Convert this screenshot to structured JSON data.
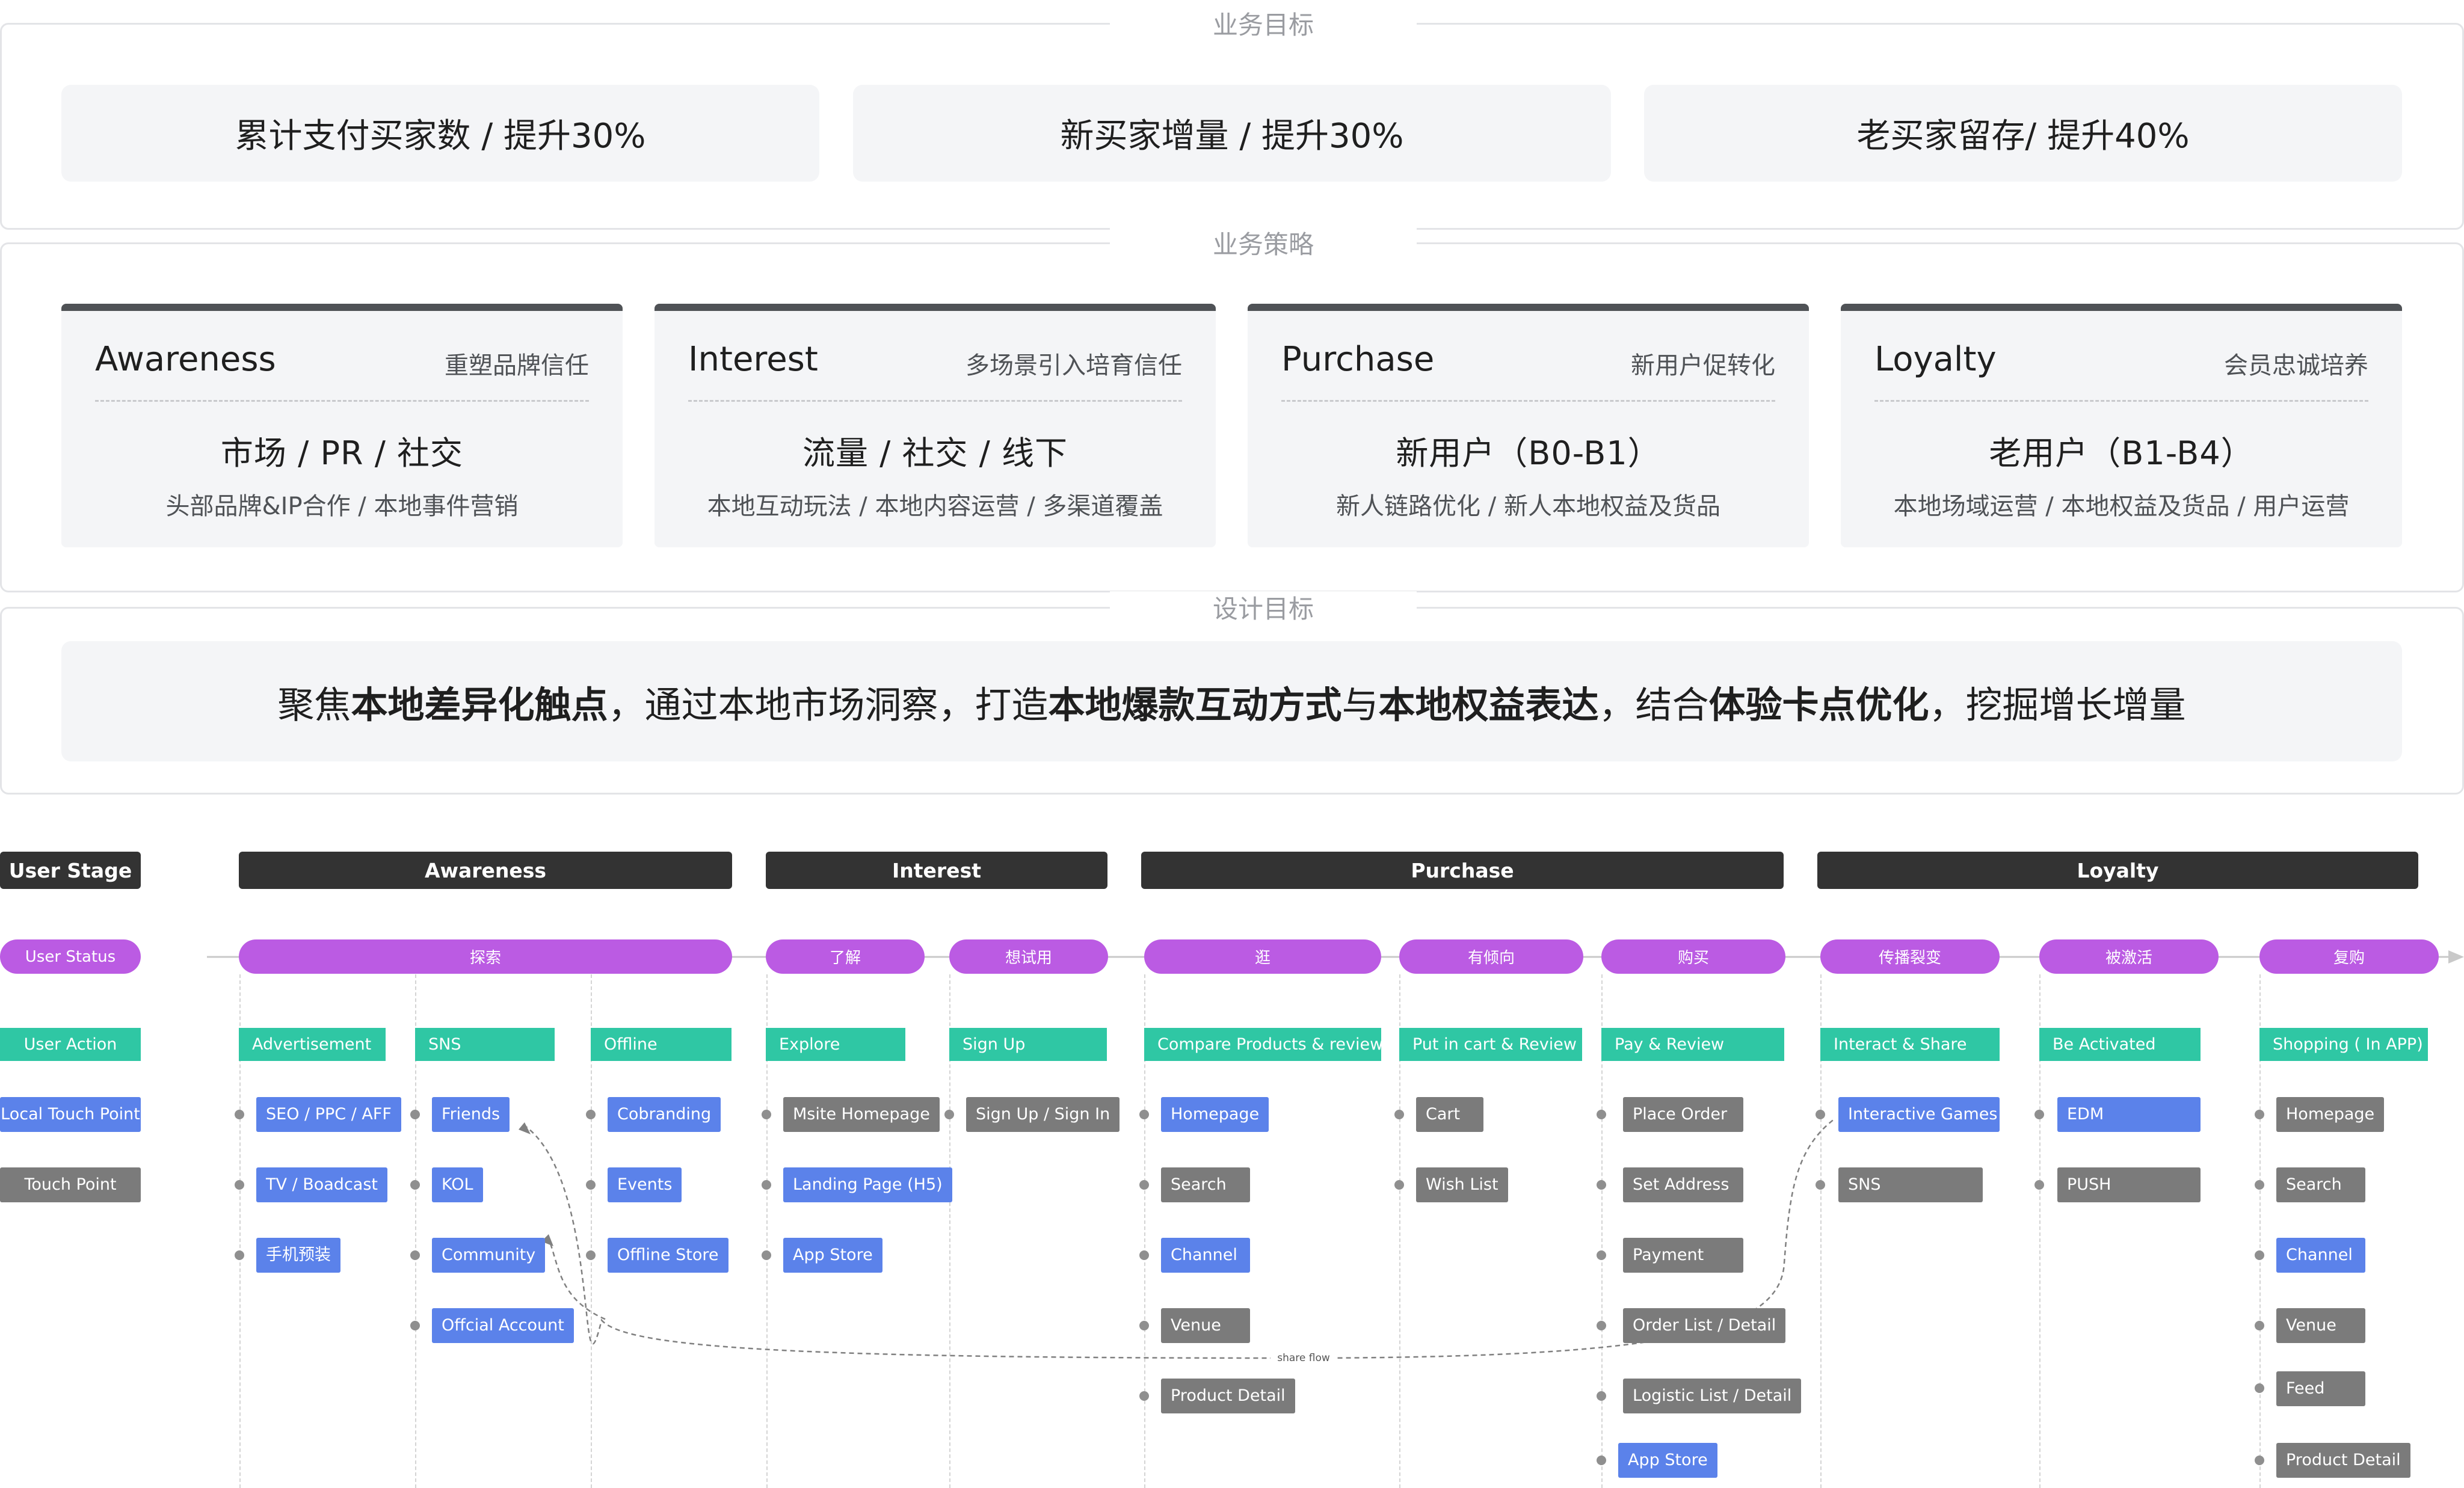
{
  "business_goals": {
    "title": "业务目标",
    "items": [
      "累计支付买家数 / 提升30%",
      "新买家增量 / 提升30%",
      "老买家留存/ 提升40%"
    ]
  },
  "business_strategy": {
    "title": "业务策略",
    "cards": [
      {
        "stage": "Awareness",
        "tag": "重塑品牌信任",
        "main": "市场 / PR / 社交",
        "sub": "头部品牌&IP合作 / 本地事件营销"
      },
      {
        "stage": "Interest",
        "tag": "多场景引入培育信任",
        "main": "流量 / 社交 / 线下",
        "sub": "本地互动玩法 / 本地内容运营 / 多渠道覆盖"
      },
      {
        "stage": "Purchase",
        "tag": "新用户促转化",
        "main": "新用户（B0-B1）",
        "sub": "新人链路优化 / 新人本地权益及货品"
      },
      {
        "stage": "Loyalty",
        "tag": "会员忠诚培养",
        "main": "老用户（B1-B4）",
        "sub": "本地场域运营 / 本地权益及货品 / 用户运营"
      }
    ]
  },
  "design_goal": {
    "title": "设计目标",
    "parts": [
      "聚焦",
      "本地差异化触点",
      "，通过本地市场洞察，打造",
      "本地爆款互动方式",
      "与",
      "本地权益表达",
      "，结合",
      "体验卡点优化",
      "，挖掘增长增量"
    ]
  },
  "journey": {
    "row_labels": {
      "stage": "User Stage",
      "status": "User Status",
      "action": "User Action",
      "local": "Local Touch Point",
      "touch": "Touch Point"
    },
    "stages": [
      "Awareness",
      "Interest",
      "Purchase",
      "Loyalty"
    ],
    "statuses": [
      "探索",
      "了解",
      "想试用",
      "逛",
      "有倾向",
      "购买",
      "传播裂变",
      "被激活",
      "复购"
    ],
    "actions": [
      "Advertisement",
      "SNS",
      "Offline",
      "Explore",
      "Sign Up",
      "Compare Products & review",
      "Put in cart & Review",
      "Pay & Review",
      "Interact & Share",
      "Be Activated",
      "Shopping ( In APP)"
    ],
    "touchpoints": [
      [
        "SEO / PPC  / AFF",
        "TV / Boadcast",
        "手机预装"
      ],
      [
        "Friends",
        "KOL",
        "Community",
        "Offcial Account"
      ],
      [
        "Cobranding",
        "Events",
        "Offline Store"
      ],
      [
        "Msite Homepage",
        "Landing Page (H5)",
        "App Store"
      ],
      [
        "Sign Up / Sign In"
      ],
      [
        "Homepage",
        "Search",
        "Channel",
        "Venue",
        "Product Detail"
      ],
      [
        "Cart",
        "Wish List"
      ],
      [
        "Place Order",
        "Set Address",
        "Payment",
        "Order List / Detail",
        "Logistic List / Detail",
        "App Store"
      ],
      [
        "Interactive Games",
        "SNS"
      ],
      [
        "EDM",
        "PUSH"
      ],
      [
        "Homepage",
        "Search",
        "Channel",
        "Venue",
        "Feed",
        "Product Detail"
      ]
    ],
    "flow_label": "share flow"
  },
  "colors": {
    "stage": "#333333",
    "status": "#bb5be3",
    "action": "#2fc7a4",
    "local_touch": "#5b82ea",
    "touch": "#7b7b7b",
    "panel_bg": "#f4f5f7"
  }
}
